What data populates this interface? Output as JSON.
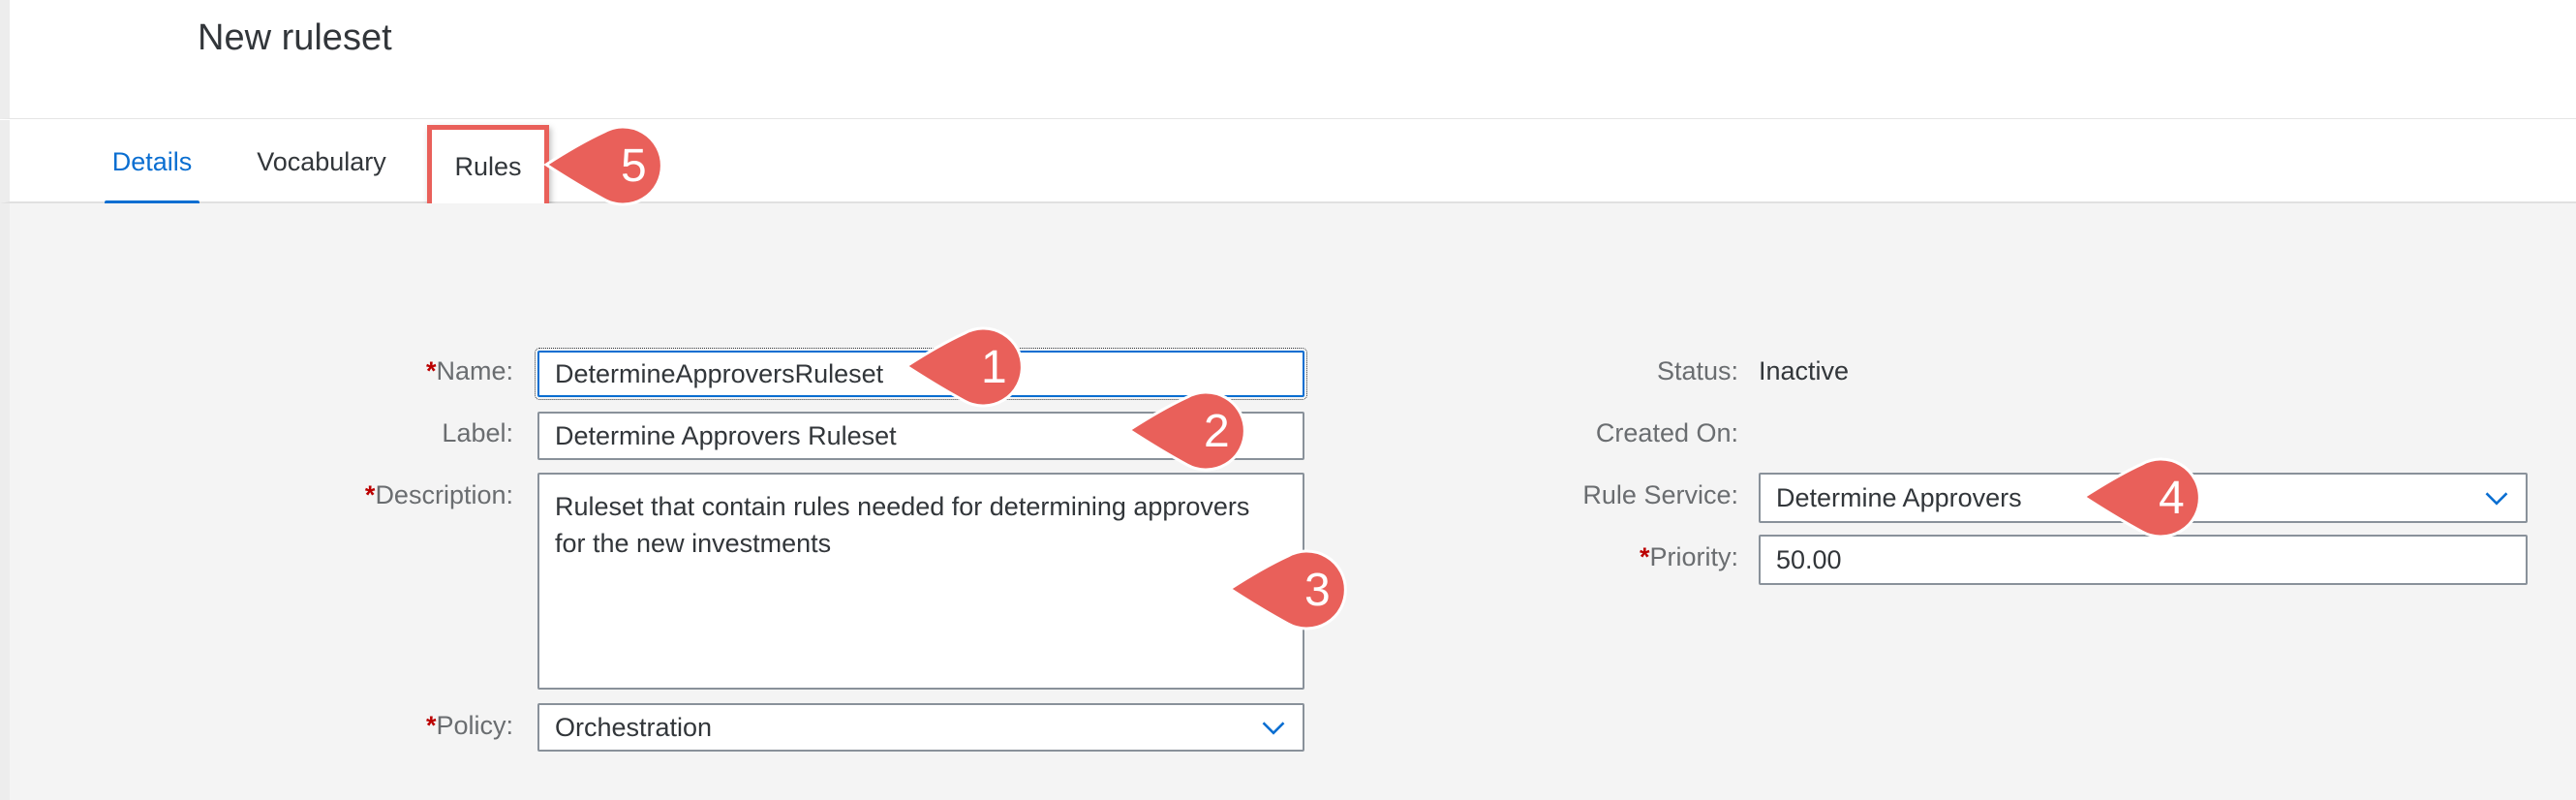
{
  "page": {
    "title": "New ruleset"
  },
  "tabs": [
    {
      "label": "Details"
    },
    {
      "label": "Vocabulary"
    },
    {
      "label": "Rules"
    }
  ],
  "form": {
    "name_label": "Name:",
    "name_value": "DetermineApproversRuleset",
    "label_label": "Label:",
    "label_value": "Determine Approvers Ruleset",
    "description_label": "Description:",
    "description_value": "Ruleset that contain rules needed for determining approvers for the new investments",
    "policy_label": "Policy:",
    "policy_value": "Orchestration",
    "status_label": "Status:",
    "status_value": "Inactive",
    "created_on_label": "Created On:",
    "rule_service_label": "Rule Service:",
    "rule_service_value": "Determine Approvers",
    "priority_label": "Priority:",
    "priority_value": "50.00",
    "required_marker": "*"
  },
  "callouts": [
    "1",
    "2",
    "3",
    "4",
    "5"
  ],
  "colors": {
    "accent": "#0a6ed1",
    "callout": "#e9605a",
    "required": "#bb0000"
  },
  "icons": {
    "dropdown": "chevron-down-icon"
  }
}
